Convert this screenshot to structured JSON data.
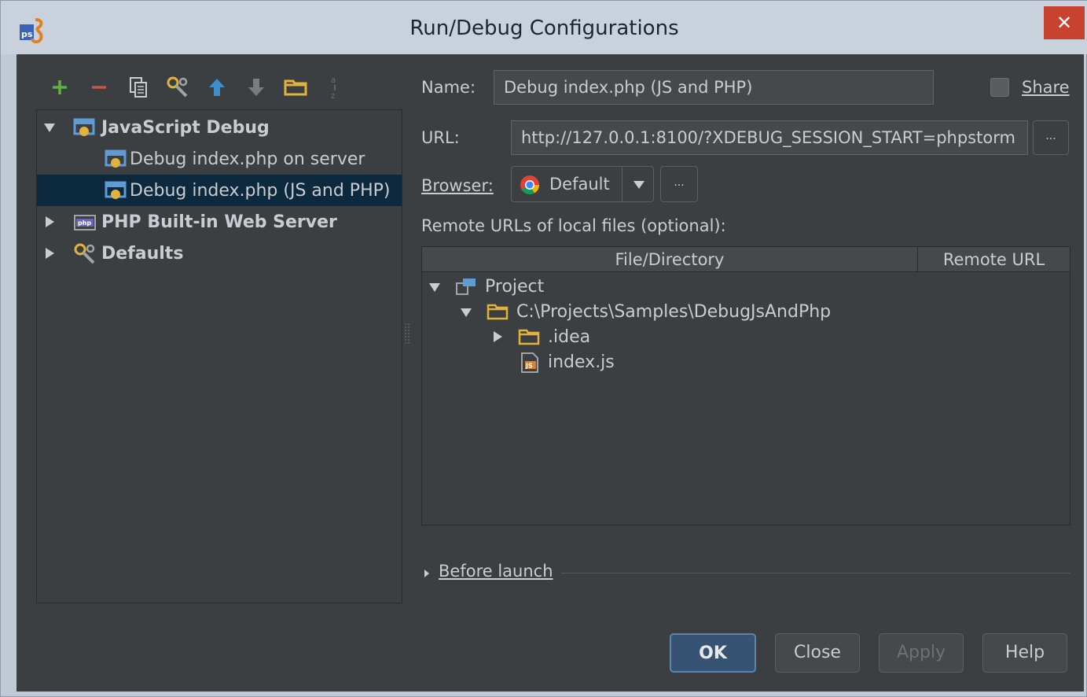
{
  "window": {
    "title": "Run/Debug Configurations",
    "close_glyph": "✕"
  },
  "toolbar": {
    "buttons": [
      {
        "name": "add-icon",
        "glyph": "+"
      },
      {
        "name": "remove-icon",
        "glyph": "−"
      },
      {
        "name": "copy-icon"
      },
      {
        "name": "edit-defaults-icon"
      },
      {
        "name": "move-up-icon"
      },
      {
        "name": "move-down-icon"
      },
      {
        "name": "folder-icon"
      },
      {
        "name": "sort-icon"
      }
    ]
  },
  "tree": {
    "items": [
      {
        "label": "JavaScript Debug",
        "level": 0,
        "expanded": true,
        "bold": true
      },
      {
        "label": "Debug index.php on server",
        "level": 1
      },
      {
        "label": "Debug index.php (JS and PHP)",
        "level": 1,
        "selected": true
      },
      {
        "label": "PHP Built-in Web Server",
        "level": 0,
        "expanded": false,
        "bold": true
      },
      {
        "label": "Defaults",
        "level": 0,
        "expanded": false,
        "bold": true
      }
    ]
  },
  "form": {
    "name_label": "Name:",
    "name_value": "Debug index.php (JS and PHP)",
    "share_label": "Share",
    "url_label": "URL:",
    "url_value": "http://127.0.0.1:8100/?XDEBUG_SESSION_START=phpstorm",
    "browse_glyph": "...",
    "browser_label": "Browser:",
    "browser_value": "Default",
    "remote_label": "Remote URLs of local files (optional):"
  },
  "table": {
    "columns": [
      "File/Directory",
      "Remote URL"
    ],
    "rows": [
      {
        "label": "Project",
        "level": 0,
        "expanded": true
      },
      {
        "label": "C:\\Projects\\Samples\\DebugJsAndPhp",
        "level": 1,
        "expanded": true
      },
      {
        "label": ".idea",
        "level": 2,
        "expanded": false
      },
      {
        "label": "index.js",
        "level": 2
      }
    ]
  },
  "before_launch": {
    "label": "Before launch"
  },
  "buttons": {
    "ok": "OK",
    "close": "Close",
    "apply": "Apply",
    "help": "Help"
  },
  "colors": {
    "background": "#3c3f41",
    "selection": "#0d293e",
    "text": "#c9ccd0",
    "add_green": "#5fb33c",
    "remove_red": "#c75450",
    "folder_yellow": "#e2b33c",
    "arrow_blue": "#3d8ece"
  }
}
